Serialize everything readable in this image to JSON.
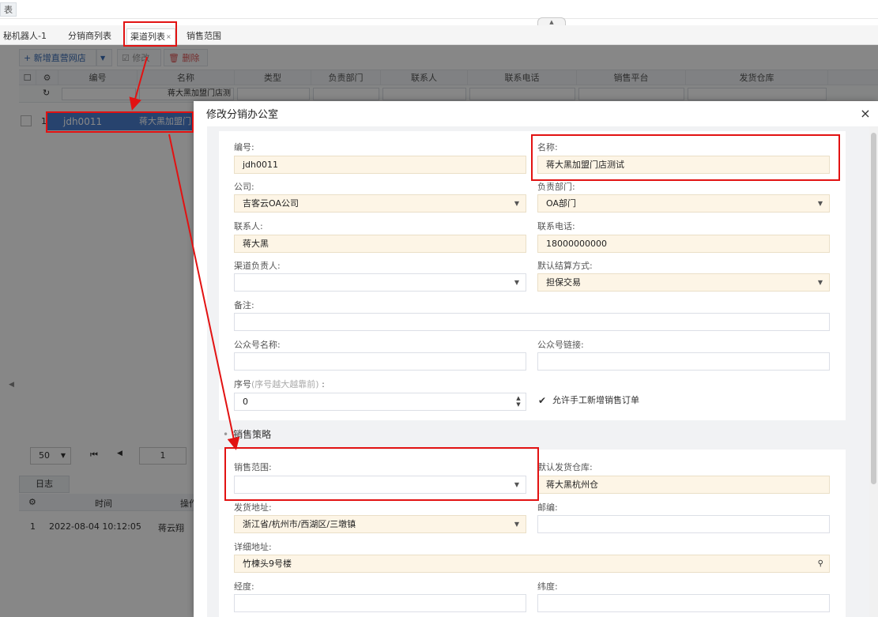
{
  "top": {
    "title": "表"
  },
  "tabs": [
    {
      "label": "秘机器人-1"
    },
    {
      "label": "分销商列表"
    },
    {
      "label": "渠道列表",
      "close": "×"
    },
    {
      "label": "销售范围"
    }
  ],
  "toolbar": {
    "add_label": "+ 新增直营网店",
    "add_caret": "▼",
    "edit_label": "☑ 修改",
    "delete_label": "🗑 删除"
  },
  "grid": {
    "columns": [
      "编号",
      "名称",
      "类型",
      "负责部门",
      "联系人",
      "联系电话",
      "销售平台",
      "发货仓库"
    ],
    "filter_name": "蒋大黑加盟门店测",
    "row": {
      "num": "1",
      "code": "jdh0011",
      "name": "蒋大黑加盟门"
    }
  },
  "pager": {
    "size": "50",
    "page": "1"
  },
  "log": {
    "tab": "日志",
    "columns": [
      "时间",
      "操作"
    ],
    "row": {
      "num": "1",
      "time": "2022-08-04 10:12:05",
      "user": "蒋云翔"
    }
  },
  "dialog": {
    "title": "修改分销办公室",
    "close": "×",
    "fields": {
      "code_label": "编号:",
      "code_value": "jdh0011",
      "name_label": "名称:",
      "name_value": "蒋大黑加盟门店测试",
      "company_label": "公司:",
      "company_value": "吉客云OA公司",
      "dept_label": "负责部门:",
      "dept_value": "OA部门",
      "contact_label": "联系人:",
      "contact_value": "蒋大黑",
      "phone_label": "联系电话:",
      "phone_value": "18000000000",
      "owner_label": "渠道负责人:",
      "owner_value": "",
      "settle_label": "默认结算方式:",
      "settle_value": "担保交易",
      "remark_label": "备注:",
      "remark_value": "",
      "wechat_name_label": "公众号名称:",
      "wechat_name_value": "",
      "wechat_link_label": "公众号链接:",
      "wechat_link_value": "",
      "seq_label": "序号",
      "seq_hint": "(序号越大越靠前)",
      "seq_colon": ":",
      "seq_value": "0",
      "allow_manual_label": "允许手工新增销售订单",
      "allow_manual_checked": "✔"
    },
    "sales_section": {
      "title": "销售策略",
      "range_label": "销售范围:",
      "range_value": "",
      "warehouse_label": "默认发货仓库:",
      "warehouse_value": "蒋大黑杭州仓",
      "ship_addr_label": "发货地址:",
      "ship_addr_value": "浙江省/杭州市/西湖区/三墩镇",
      "zip_label": "邮编:",
      "zip_value": "",
      "detail_addr_label": "详细地址:",
      "detail_addr_value": "竹楝头9号楼",
      "lng_label": "经度:",
      "lat_label": "纬度:"
    }
  },
  "colors": {
    "annotation_red": "#e21212",
    "accent_blue": "#3a6db5",
    "required_bg": "#fdf5e6"
  }
}
